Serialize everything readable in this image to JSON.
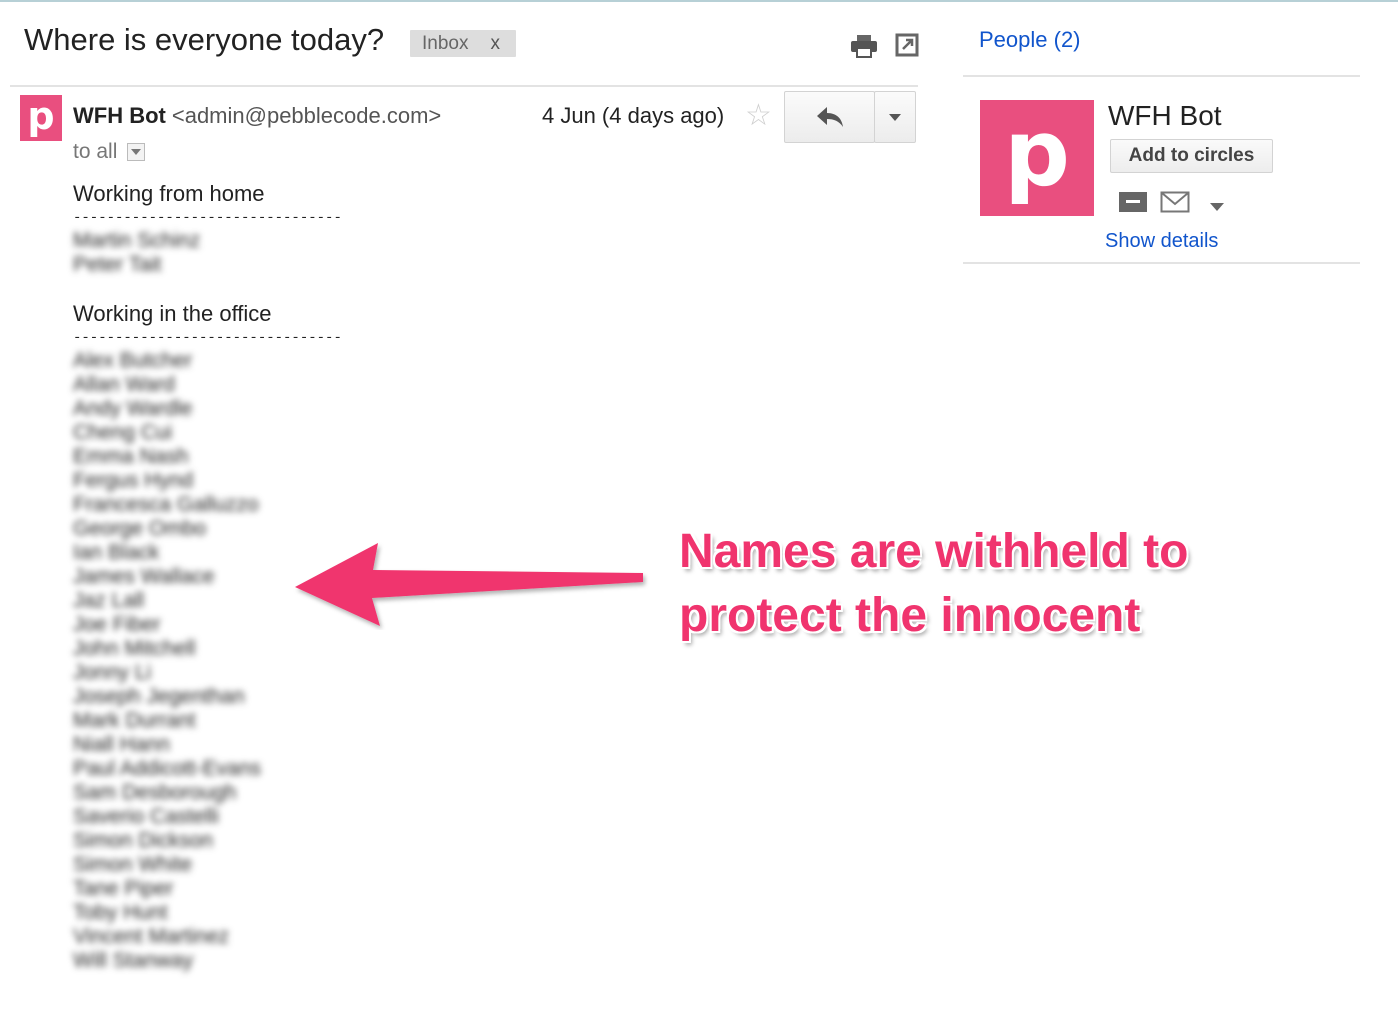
{
  "email": {
    "subject": "Where is everyone today?",
    "label": "Inbox",
    "label_remove": "x",
    "sender_initial": "p",
    "sender_name": "WFH Bot",
    "sender_email": "<admin@pebblecode.com>",
    "recipients": "to all",
    "date": "4 Jun (4 days ago)"
  },
  "body": {
    "section_home": "Working from home",
    "section_office": "Working in the office",
    "separator": "--------------------------------",
    "home_names": [
      "Martin Schinz",
      "Peter Tait"
    ],
    "office_names": [
      "Alex Butcher",
      "Allan Ward",
      "Andy Wardle",
      "Cheng Cui",
      "Emma Nash",
      "Fergus Hynd",
      "Francesca Galluzzo",
      "George Ombo",
      "Ian Black",
      "James Wallace",
      "Jaz Lall",
      "Joe Fiber",
      "John Mitchell",
      "Jonny Li",
      "Joseph Jegenthan",
      "Mark Durrant",
      "Niall Hann",
      "Paul Addicott-Evans",
      "Sam Desborough",
      "Saverio Castelli",
      "Simon Dickson",
      "Simon White",
      "Tane Piper",
      "Toby Hunt",
      "Vincent Martinez",
      "Will Stanway"
    ]
  },
  "annotation": {
    "line1": "Names are withheld to",
    "line2": "protect the innocent",
    "color": "#f0346e"
  },
  "sidebar": {
    "people_link": "People (2)",
    "contact_initial": "p",
    "contact_name": "WFH Bot",
    "add_to_circles": "Add to circles",
    "show_details": "Show details"
  },
  "colors": {
    "avatar": "#e94f7f",
    "link": "#1155cc",
    "annotation": "#f0346e"
  },
  "icons": [
    "print-icon",
    "new-window-icon",
    "star-icon",
    "reply-icon",
    "dropdown-arrow-icon",
    "archive-icon",
    "email-icon"
  ]
}
